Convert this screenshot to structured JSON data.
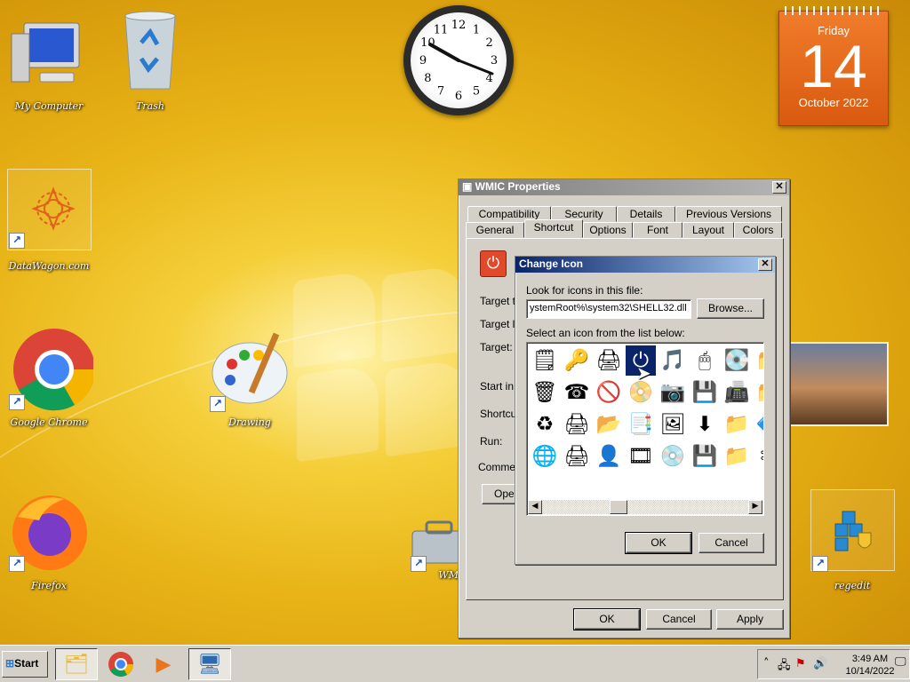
{
  "desktop": {
    "icons": [
      {
        "label": "My Computer",
        "icon": "computer-icon"
      },
      {
        "label": "Trash",
        "icon": "recycle-bin-icon"
      },
      {
        "label": "DataWagon.com",
        "icon": "datawagon-icon"
      },
      {
        "label": "Google Chrome",
        "icon": "chrome-icon"
      },
      {
        "label": "Drawing",
        "icon": "paint-palette-icon"
      },
      {
        "label": "Firefox",
        "icon": "firefox-icon"
      },
      {
        "label": "WM",
        "icon": "toolbox-icon"
      },
      {
        "label": "regedit",
        "icon": "registry-icon"
      }
    ],
    "clock_numbers": [
      "12",
      "1",
      "2",
      "3",
      "4",
      "5",
      "6",
      "7",
      "8",
      "9",
      "10",
      "11"
    ],
    "calendar": {
      "day": "Friday",
      "date": "14",
      "month": "October 2022"
    }
  },
  "props": {
    "title": "WMIC Properties",
    "tabs_row1": [
      "Compatibility",
      "Security",
      "Details",
      "Previous Versions"
    ],
    "tabs_row2": [
      "General",
      "Shortcut",
      "Options",
      "Font",
      "Layout",
      "Colors"
    ],
    "active_tab": "Shortcut",
    "labels": [
      "Target ty",
      "Target lo",
      "Target:",
      "Start in:",
      "Shortcut",
      "Run:",
      "Commen"
    ],
    "open_button": "Open",
    "ok": "OK",
    "cancel": "Cancel",
    "apply": "Apply"
  },
  "change_icon": {
    "title": "Change Icon",
    "look_label": "Look for icons in this file:",
    "path_value": "ystemRoot%\\system32\\SHELL32.dll",
    "browse": "Browse...",
    "select_label": "Select an icon from the list below:",
    "icons": [
      "🗒",
      "🔑",
      "🖨",
      "⏻",
      "🎵",
      "🖱",
      "💽",
      "📁",
      "🗑",
      "☎",
      "🚫",
      "📀",
      "📷",
      "💾",
      "📠",
      "📁",
      "♻",
      "🖨",
      "📂",
      "📑",
      "🖼",
      "⬇",
      "📁",
      "🔷",
      "🌐",
      "🖨",
      "👤",
      "🎞",
      "💿",
      "💾",
      "📁",
      "✂"
    ],
    "selected_index": 3,
    "ok": "OK",
    "cancel": "Cancel"
  },
  "taskbar": {
    "start_label": "Start",
    "apps": [
      "explorer-icon",
      "chrome-icon",
      "media-player-icon",
      "control-panel-icon"
    ],
    "time": "3:49 AM",
    "date": "10/14/2022"
  },
  "colors": {
    "desktop_yellow": "#e8b417",
    "calendar_orange": "#e66a1c",
    "active_title": "#0a246a",
    "dialog_face": "#d4d0c8"
  }
}
